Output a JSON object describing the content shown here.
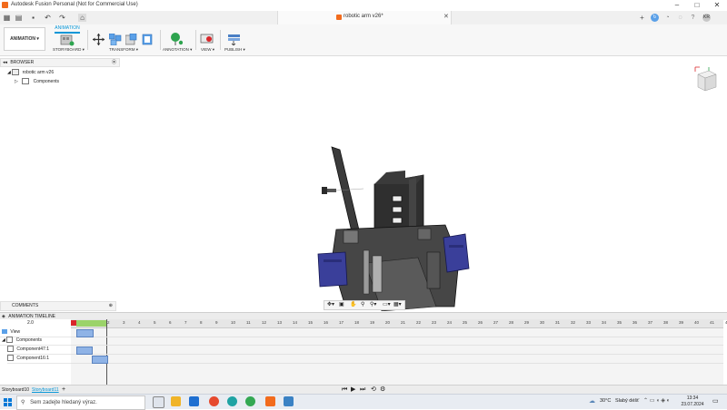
{
  "window": {
    "title": "Autodesk Fusion Personal (Not for Commercial Use)",
    "document_tab": "robotic arm v26*"
  },
  "toolbar": {
    "workspace": "ANIMATION",
    "active_tab": "ANIMATION",
    "groups": [
      "STORYBOARD",
      "TRANSFORM",
      "ANNOTATION",
      "VIEW",
      "PUBLISH"
    ]
  },
  "browser": {
    "header": "BROWSER",
    "root": "robotic arm v26",
    "child": "Components"
  },
  "comments": {
    "label": "COMMENTS"
  },
  "timeline": {
    "header": "ANIMATION TIMELINE",
    "time": "2.0",
    "ruler_ticks": [
      "0",
      "1",
      "2",
      "3",
      "4",
      "5",
      "6",
      "7",
      "8",
      "9",
      "10",
      "11",
      "12",
      "13",
      "14",
      "15",
      "16",
      "17",
      "18",
      "19",
      "20",
      "21",
      "22",
      "23",
      "24",
      "25",
      "26",
      "27",
      "28",
      "29",
      "30",
      "31",
      "32",
      "33",
      "34",
      "35",
      "36",
      "37",
      "38",
      "39",
      "40",
      "41",
      "42"
    ],
    "rows": [
      "View",
      "Components",
      "Component47:1",
      "Component16:1"
    ]
  },
  "storyboards": [
    "Storyboard10",
    "Storyboard11"
  ],
  "taskbar": {
    "search_placeholder": "Sem zadejte hledaný výraz.",
    "weather_temp": "30°C",
    "weather_desc": "Slabý déšť",
    "time": "13:34",
    "date": "23.07.2024"
  },
  "user_initials": "KR",
  "colors": {
    "accent": "#0696d7",
    "fusion_orange": "#f26b1d",
    "part_blue": "#3a3f9a"
  }
}
